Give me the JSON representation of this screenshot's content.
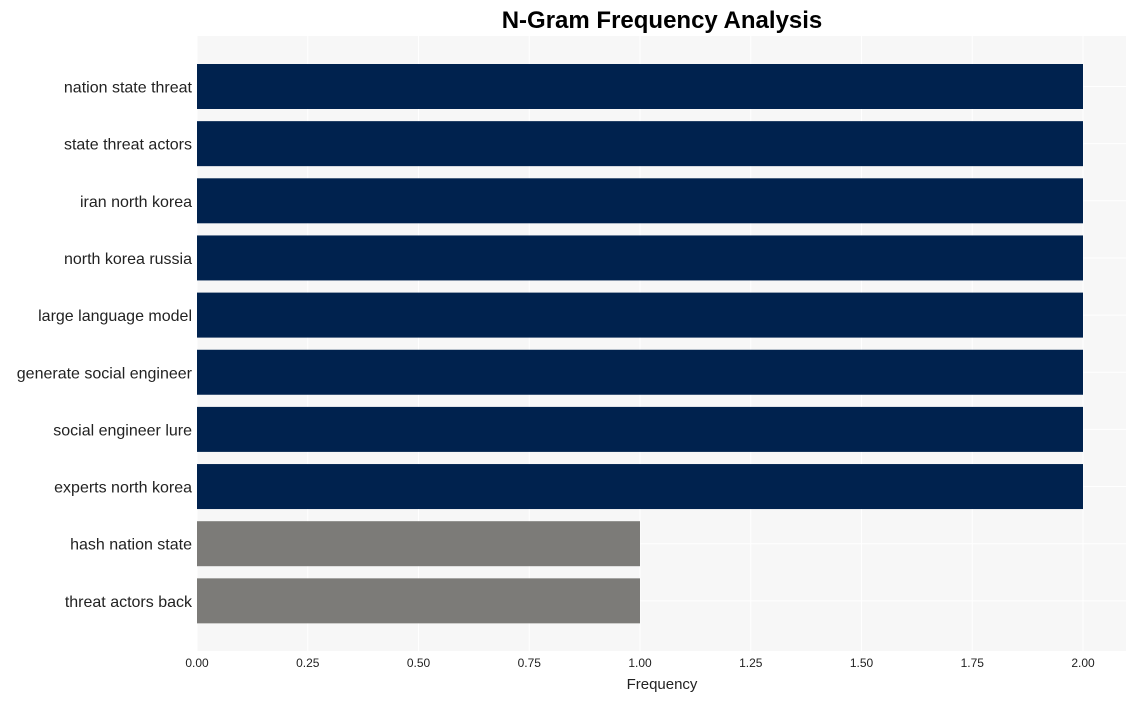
{
  "chart_data": {
    "type": "bar",
    "orientation": "horizontal",
    "title": "N-Gram Frequency Analysis",
    "xlabel": "Frequency",
    "ylabel": "",
    "xlim": [
      0,
      2.0
    ],
    "xticks": [
      "0.00",
      "0.25",
      "0.50",
      "0.75",
      "1.00",
      "1.25",
      "1.50",
      "1.75",
      "2.00"
    ],
    "grid": true,
    "categories": [
      "nation state threat",
      "state threat actors",
      "iran north korea",
      "north korea russia",
      "large language model",
      "generate social engineer",
      "social engineer lure",
      "experts north korea",
      "hash nation state",
      "threat actors back"
    ],
    "values": [
      2,
      2,
      2,
      2,
      2,
      2,
      2,
      2,
      1,
      1
    ],
    "colors": {
      "high": "#00224e",
      "low": "#7c7b78",
      "plot_bg": "#f7f7f7",
      "grid": "#ffffff"
    }
  }
}
